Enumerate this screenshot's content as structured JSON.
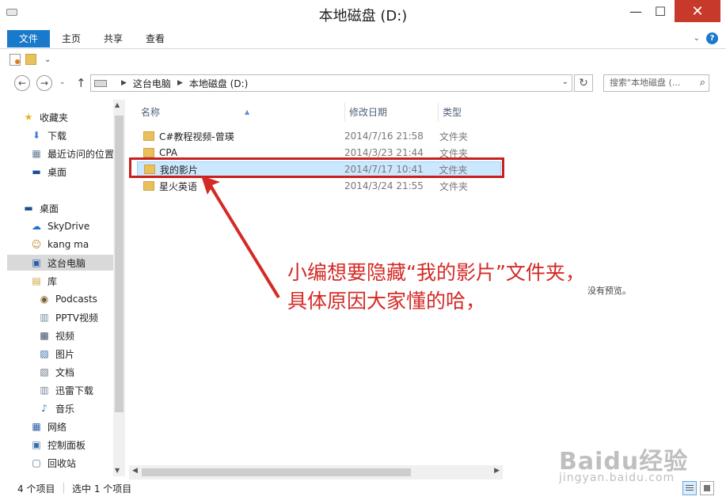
{
  "window": {
    "title": "本地磁盘 (D:)",
    "min": "—",
    "max": "☐",
    "close": "✕"
  },
  "ribbon": {
    "tabs": [
      "文件",
      "主页",
      "共享",
      "查看"
    ],
    "collapse": "⌄",
    "help": "?"
  },
  "nav": {
    "back": "←",
    "forward": "→",
    "recent": "⌄",
    "up": "↑",
    "crumbs": [
      "这台电脑",
      "本地磁盘 (D:)"
    ],
    "separator": "▶",
    "dropdown": "⌄",
    "refresh": "↻",
    "search_placeholder": "搜索\"本地磁盘 (...",
    "search_icon": "⌕"
  },
  "sidebar": {
    "items": [
      {
        "label": "收藏夹",
        "icon": "star-icon",
        "glyph": "★"
      },
      {
        "label": "下载",
        "icon": "download-icon",
        "glyph": "⬇"
      },
      {
        "label": "最近访问的位置",
        "icon": "recent-places-icon",
        "glyph": "▦"
      },
      {
        "label": "桌面",
        "icon": "desktop-icon",
        "glyph": "▬"
      },
      {
        "label": "桌面",
        "icon": "desktop-icon",
        "glyph": "▬"
      },
      {
        "label": "SkyDrive",
        "icon": "cloud-icon",
        "glyph": "☁"
      },
      {
        "label": "kang ma",
        "icon": "user-icon",
        "glyph": "☺"
      },
      {
        "label": "这台电脑",
        "icon": "computer-icon",
        "glyph": "▣"
      },
      {
        "label": "库",
        "icon": "library-icon",
        "glyph": "▤"
      },
      {
        "label": "Podcasts",
        "icon": "podcast-icon",
        "glyph": "◉"
      },
      {
        "label": "PPTV视频",
        "icon": "video-library-icon",
        "glyph": "▥"
      },
      {
        "label": "视频",
        "icon": "video-icon",
        "glyph": "▩"
      },
      {
        "label": "图片",
        "icon": "picture-icon",
        "glyph": "▨"
      },
      {
        "label": "文档",
        "icon": "document-icon",
        "glyph": "▧"
      },
      {
        "label": "迅雷下载",
        "icon": "thunder-download-icon",
        "glyph": "▥"
      },
      {
        "label": "音乐",
        "icon": "music-icon",
        "glyph": "♪"
      },
      {
        "label": "网络",
        "icon": "network-icon",
        "glyph": "▦"
      },
      {
        "label": "控制面板",
        "icon": "control-panel-icon",
        "glyph": "▣"
      },
      {
        "label": "回收站",
        "icon": "recycle-bin-icon",
        "glyph": "▢"
      }
    ],
    "scroll_up": "▲",
    "scroll_down": "▼"
  },
  "columns": {
    "name": "名称",
    "date": "修改日期",
    "type": "类型",
    "sort": "▲"
  },
  "files": [
    {
      "name": "C#教程视频-曾瑛",
      "date": "2014/7/16 21:58",
      "type": "文件夹"
    },
    {
      "name": "CPA",
      "date": "2014/3/23 21:44",
      "type": "文件夹"
    },
    {
      "name": "我的影片",
      "date": "2014/7/17 10:41",
      "type": "文件夹"
    },
    {
      "name": "星火英语",
      "date": "2014/3/24 21:55",
      "type": "文件夹"
    }
  ],
  "hscroll": {
    "left": "◀",
    "right": "▶"
  },
  "preview": {
    "empty": "没有预览。"
  },
  "annotation": {
    "text": "小编想要隐藏“我的影片”文件夹，具体原因大家懂的哈，"
  },
  "status": {
    "count": "4 个项目",
    "selected": "选中 1 个项目"
  },
  "watermark": {
    "logo": "Baidu经验",
    "url": "jingyan.baidu.com"
  },
  "colors": {
    "accent": "#1979ca",
    "annotation": "#d42a26",
    "selection": "#cce8ff"
  }
}
